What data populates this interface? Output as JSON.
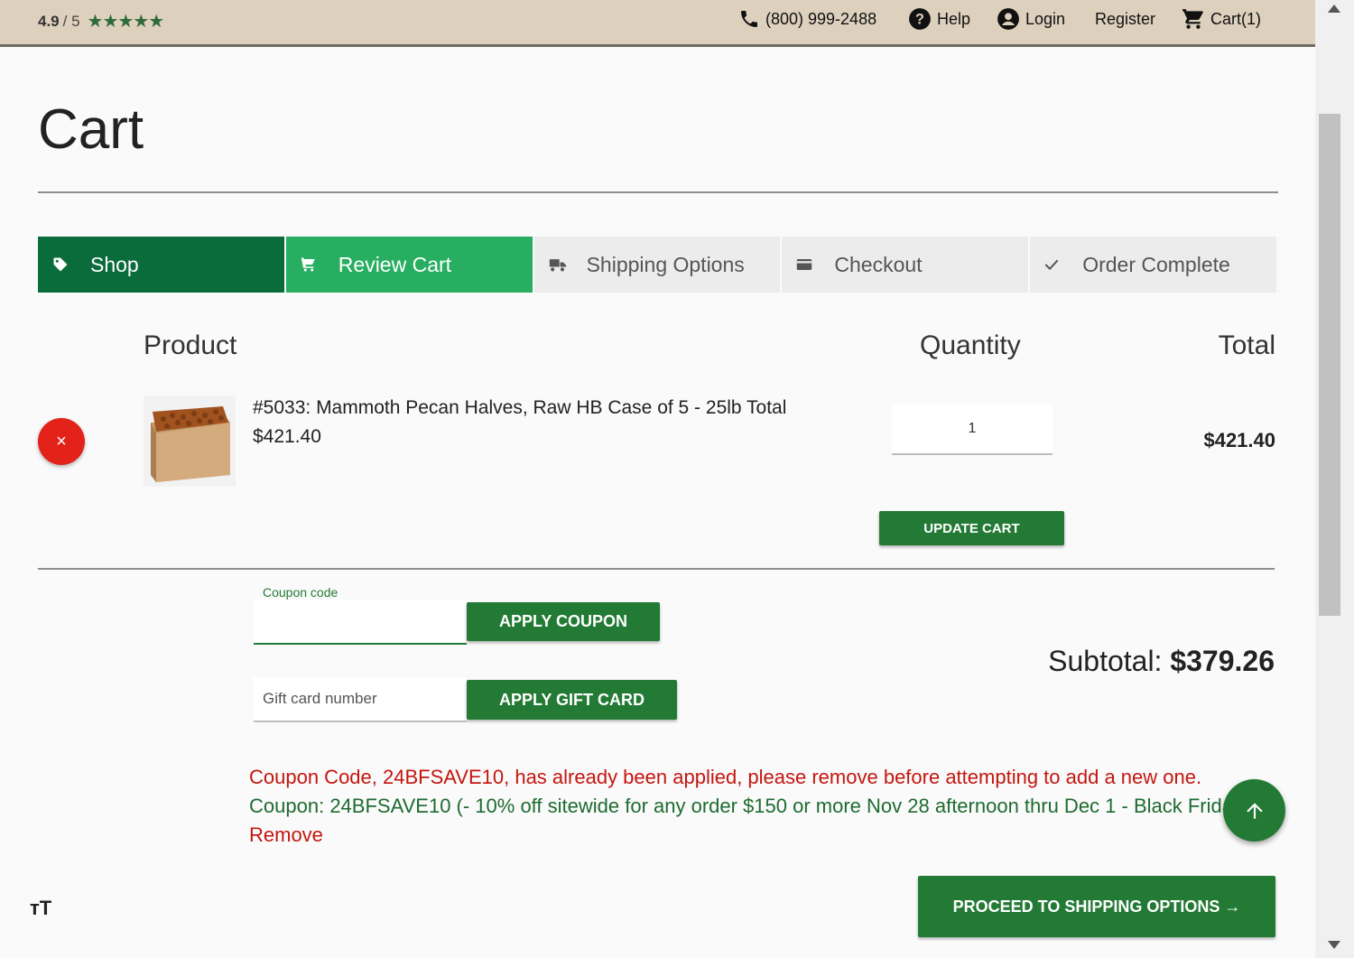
{
  "header": {
    "rating_score": "4.9",
    "rating_out_of": "/ 5",
    "stars": "★★★★★",
    "phone": "(800) 999-2488",
    "help": "Help",
    "login": "Login",
    "register": "Register",
    "cart": "Cart(1)"
  },
  "page": {
    "title": "Cart"
  },
  "steps": [
    {
      "label": "Shop",
      "icon": "tag-icon",
      "state": "done"
    },
    {
      "label": "Review Cart",
      "icon": "cart-icon",
      "state": "active"
    },
    {
      "label": "Shipping Options",
      "icon": "truck-icon",
      "state": "pending"
    },
    {
      "label": "Checkout",
      "icon": "credit-card-icon",
      "state": "pending"
    },
    {
      "label": "Order Complete",
      "icon": "check-icon",
      "state": "pending"
    }
  ],
  "table": {
    "headers": {
      "product": "Product",
      "quantity": "Quantity",
      "total": "Total"
    },
    "items": [
      {
        "name": "#5033: Mammoth Pecan Halves, Raw HB Case of 5 - 25lb Total",
        "price": "$421.40",
        "quantity": "1",
        "total": "$421.40"
      }
    ],
    "remove_glyph": "×",
    "update_label": "UPDATE CART"
  },
  "coupon": {
    "label": "Coupon code",
    "value": "",
    "apply_label": "APPLY COUPON"
  },
  "gift_card": {
    "placeholder": "Gift card number",
    "apply_label": "APPLY GIFT CARD"
  },
  "summary": {
    "subtotal_label": "Subtotal:",
    "subtotal_value": "$379.26"
  },
  "messages": {
    "error": "Coupon Code, 24BFSAVE10, has already been applied, please remove before attempting to add a new one.",
    "coupon_prefix": "Coupon:",
    "coupon_text": "24BFSAVE10 (- 10% off sitewide for any order $150 or more Nov 28 afternoon thru Dec 1 - Black Friday",
    "remove_label": "Remove"
  },
  "actions": {
    "proceed_label": "PROCEED TO SHIPPING OPTIONS →",
    "text_size_glyph": "тT"
  },
  "colors": {
    "topbar": "#ddd0bd",
    "step_done": "#0a6b3b",
    "step_active": "#27ae60",
    "button_green": "#237a34",
    "error_red": "#c4160f"
  }
}
